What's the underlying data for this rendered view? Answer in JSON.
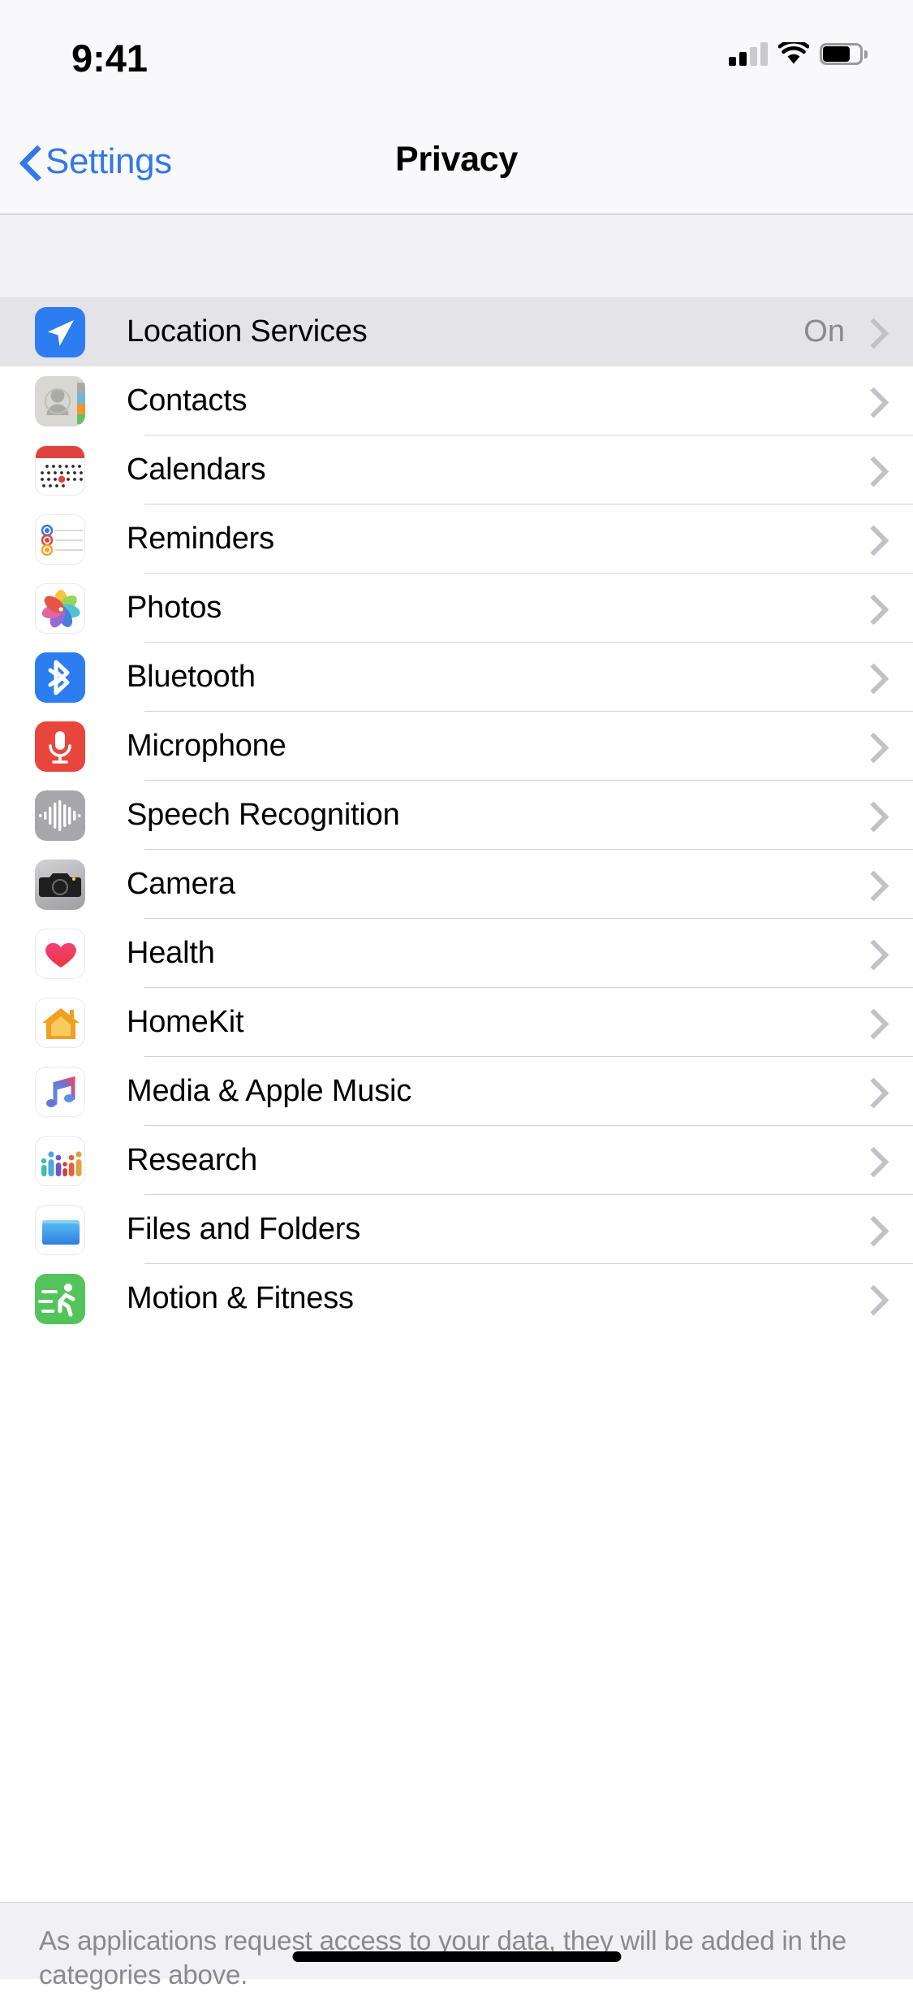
{
  "status_bar": {
    "time": "9:41",
    "cellular_icon": "cellular-signal-icon",
    "cellular_bars_filled": 2,
    "cellular_bars_total": 4,
    "wifi_icon": "wifi-icon",
    "battery_icon": "battery-icon",
    "battery_level_percent": 75
  },
  "nav_bar": {
    "back_icon": "chevron-left-icon",
    "back_label": "Settings",
    "title": "Privacy"
  },
  "list": {
    "items": [
      {
        "label": "Location Services",
        "icon": "location-services-icon",
        "value": "On",
        "selected": true,
        "accessory": "chevron-right-icon"
      },
      {
        "label": "Contacts",
        "icon": "contacts-icon",
        "value": "",
        "selected": false,
        "accessory": "chevron-right-icon"
      },
      {
        "label": "Calendars",
        "icon": "calendars-icon",
        "value": "",
        "selected": false,
        "accessory": "chevron-right-icon"
      },
      {
        "label": "Reminders",
        "icon": "reminders-icon",
        "value": "",
        "selected": false,
        "accessory": "chevron-right-icon"
      },
      {
        "label": "Photos",
        "icon": "photos-icon",
        "value": "",
        "selected": false,
        "accessory": "chevron-right-icon"
      },
      {
        "label": "Bluetooth",
        "icon": "bluetooth-icon",
        "value": "",
        "selected": false,
        "accessory": "chevron-right-icon"
      },
      {
        "label": "Microphone",
        "icon": "microphone-icon",
        "value": "",
        "selected": false,
        "accessory": "chevron-right-icon"
      },
      {
        "label": "Speech Recognition",
        "icon": "speech-recognition-icon",
        "value": "",
        "selected": false,
        "accessory": "chevron-right-icon"
      },
      {
        "label": "Camera",
        "icon": "camera-icon",
        "value": "",
        "selected": false,
        "accessory": "chevron-right-icon"
      },
      {
        "label": "Health",
        "icon": "health-icon",
        "value": "",
        "selected": false,
        "accessory": "chevron-right-icon"
      },
      {
        "label": "HomeKit",
        "icon": "homekit-icon",
        "value": "",
        "selected": false,
        "accessory": "chevron-right-icon"
      },
      {
        "label": "Media & Apple Music",
        "icon": "media-apple-music-icon",
        "value": "",
        "selected": false,
        "accessory": "chevron-right-icon"
      },
      {
        "label": "Research",
        "icon": "research-icon",
        "value": "",
        "selected": false,
        "accessory": "chevron-right-icon"
      },
      {
        "label": "Files and Folders",
        "icon": "files-and-folders-icon",
        "value": "",
        "selected": false,
        "accessory": "chevron-right-icon"
      },
      {
        "label": "Motion & Fitness",
        "icon": "motion-fitness-icon",
        "value": "",
        "selected": false,
        "accessory": "chevron-right-icon"
      }
    ]
  },
  "footer": {
    "text": "As applications request access to your data, they will be added in the categories above."
  },
  "colors": {
    "tint": "#3478E8",
    "location_blue": "#2C7DF0",
    "microphone_red": "#E8463C",
    "motion_green": "#53C45B",
    "group_background": "#F1F1F5",
    "selected_row": "#E3E3E8",
    "secondary_text": "#8A8A8E",
    "separator": "#D2D2D6"
  }
}
